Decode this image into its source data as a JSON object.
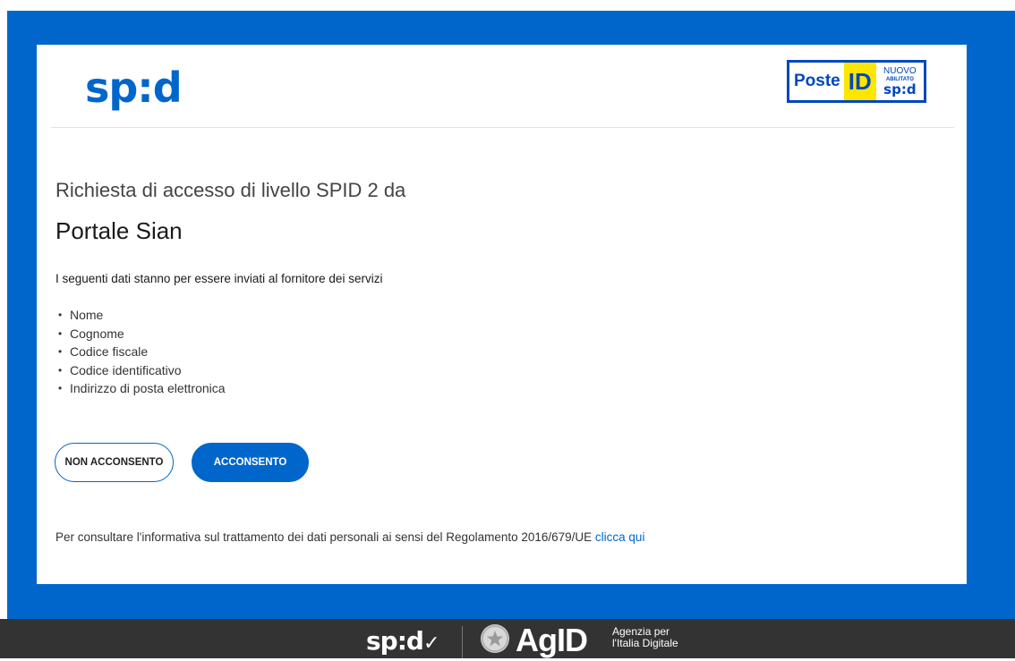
{
  "header": {
    "logo_text": "sp:d",
    "badge": {
      "poste": "Poste",
      "id": "ID",
      "nuovo": "NUOVO",
      "abilitato": "ABILITATO",
      "spid": "sp:d"
    }
  },
  "request": {
    "line": "Richiesta di accesso di livello SPID 2 da",
    "portal": "Portale Sian",
    "intro": "I seguenti dati stanno per essere inviati al fornitore dei servizi",
    "attributes": [
      "Nome",
      "Cognome",
      "Codice fiscale",
      "Codice identificativo",
      "Indirizzo di posta elettronica"
    ]
  },
  "buttons": {
    "deny": "NON ACCONSENTO",
    "accept": "ACCONSENTO"
  },
  "privacy": {
    "text": "Per consultare l'informativa sul trattamento dei dati personali ai sensi del Regolamento 2016/679/UE ",
    "link": "clicca qui"
  },
  "footer": {
    "spid": "sp:d",
    "agid": "AgID",
    "agency_line1": "Agenzia per",
    "agency_line2": "l'Italia Digitale"
  },
  "colors": {
    "brand_blue": "#0066cc",
    "footer_bg": "#333333",
    "poste_yellow": "#ffe600"
  }
}
